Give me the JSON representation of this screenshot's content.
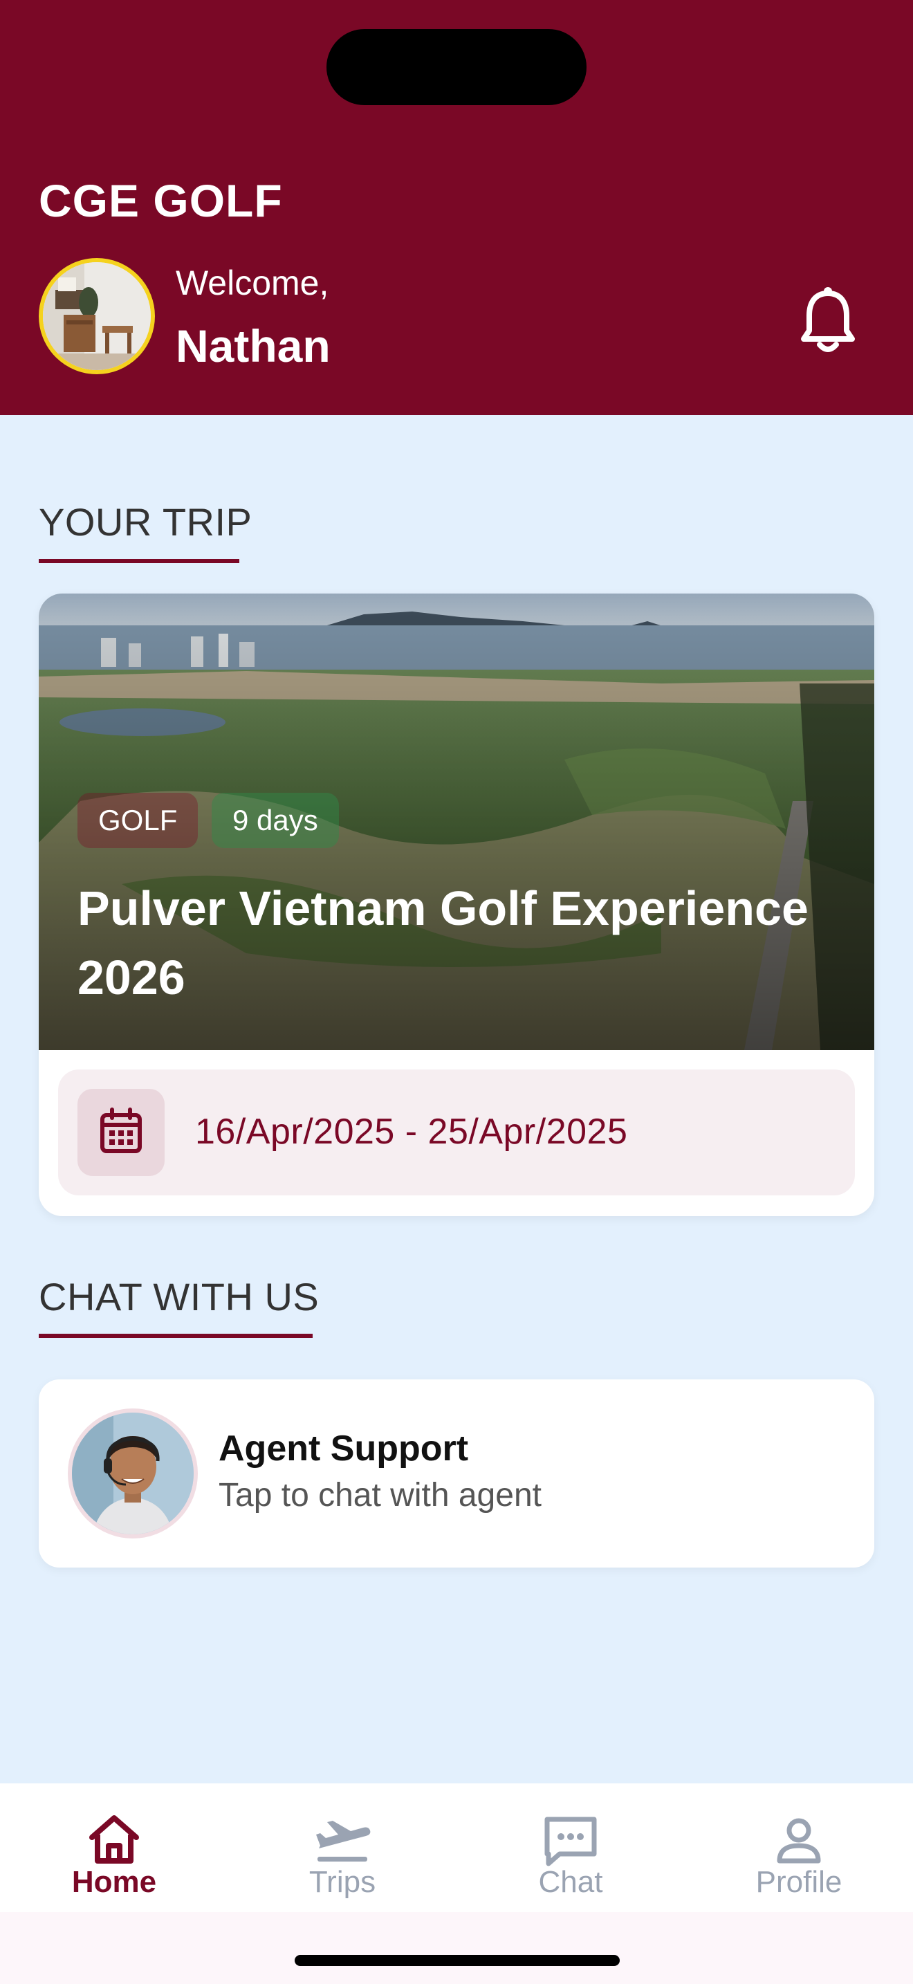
{
  "header": {
    "app_title": "CGE GOLF",
    "welcome_label": "Welcome,",
    "user_name": "Nathan",
    "background_color": "#7A0826"
  },
  "your_trip": {
    "section_title": "YOUR TRIP",
    "card": {
      "category_tag": "GOLF",
      "duration_tag": "9 days",
      "title": "Pulver Vietnam Golf Experience 2026",
      "date_range": "16/Apr/2025 - 25/Apr/2025",
      "date_icon": "calendar-icon"
    }
  },
  "chat_with_us": {
    "section_title": "CHAT WITH US",
    "agent": {
      "name": "Agent Support",
      "subtitle": "Tap to chat with agent"
    }
  },
  "bottom_nav": {
    "items": [
      {
        "label": "Home",
        "icon": "home-icon",
        "active": true
      },
      {
        "label": "Trips",
        "icon": "plane-departure-icon",
        "active": false
      },
      {
        "label": "Chat",
        "icon": "chat-bubble-icon",
        "active": false
      },
      {
        "label": "Profile",
        "icon": "person-icon",
        "active": false
      }
    ]
  },
  "colors": {
    "brand": "#7A0826",
    "page_background": "#E3F0FD",
    "inactive_nav": "#9AA3B2",
    "avatar_ring": "#F5D21E"
  }
}
